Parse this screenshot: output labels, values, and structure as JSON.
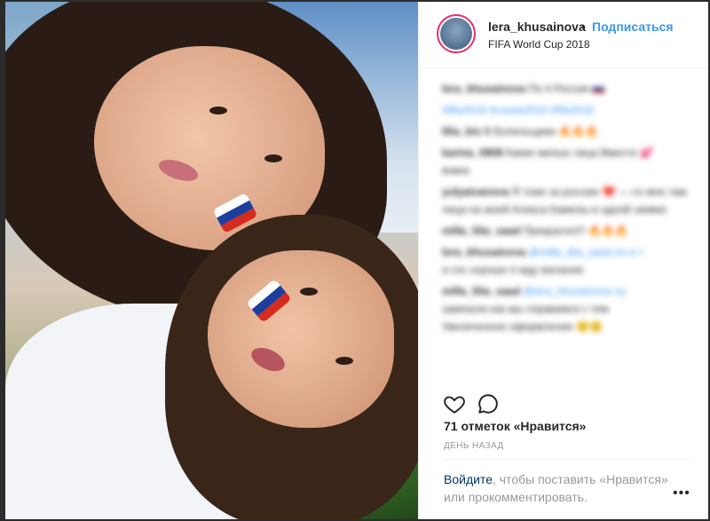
{
  "post": {
    "username": "lera_khusainova",
    "separator": "•",
    "follow_label": "Подписаться",
    "location": "FIFA World Cup 2018",
    "likes_text": "71 отметок «Нравится»",
    "time_text": "ДЕНЬ НАЗАД"
  },
  "comments": [
    {
      "user": "lera_khusainova",
      "text": "По 4 Россия 🇷🇺"
    },
    {
      "user": "",
      "text": "#fifa2018 #russia2018 #fifa2018"
    },
    {
      "user": "lilia_bis",
      "text": "В Болельщики 🔥🔥🔥"
    },
    {
      "user": "karina_0808",
      "text": "Какие милые лица Вместе 💕"
    },
    {
      "user": "",
      "text": "вовек"
    },
    {
      "user": "yulyaivanova",
      "text": "Я тоже за россию ❤️ — со мне там"
    },
    {
      "user": "",
      "text": "лица на моей Алекса Камилы в одной заявке"
    },
    {
      "user": "milla_lilia_saad",
      "text": "Прекрасно!!! 🔥🔥🔥"
    },
    {
      "user": "lera_khusainova",
      "text": "@milla_lilia_saad но а т"
    },
    {
      "user": "",
      "text": "я спс хорошо я жду желания"
    },
    {
      "user": "milla_lilia_saad",
      "text": "@lera_khusainova ну"
    },
    {
      "user": "",
      "text": "завязала как мы справимся с тем"
    },
    {
      "user": "",
      "text": "Увеличенное оформление 😊😊"
    }
  ],
  "login": {
    "link_label": "Войдите",
    "text_after": ", чтобы поставить «Нравится» или прокомментировать."
  },
  "more_label": "•••",
  "icons": {
    "like": "heart-icon",
    "comment": "speech-bubble-icon"
  },
  "colors": {
    "accent": "#3897f0",
    "text": "#262626",
    "muted": "#999999",
    "link": "#003569",
    "story_ring": "#e1306c"
  }
}
